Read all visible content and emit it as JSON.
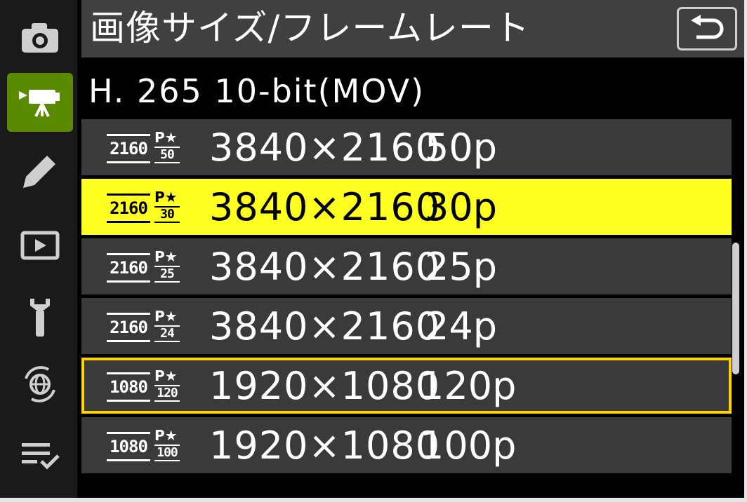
{
  "header": {
    "title": "画像サイズ/フレームレート"
  },
  "subtitle": "H. 265 10-bit(MOV)",
  "sidebar": {
    "items": [
      {
        "icon": "camera-icon"
      },
      {
        "icon": "movie-camera-icon",
        "active": true
      },
      {
        "icon": "pencil-icon"
      },
      {
        "icon": "playback-icon"
      },
      {
        "icon": "wrench-icon"
      },
      {
        "icon": "network-icon"
      },
      {
        "icon": "my-menu-icon"
      }
    ]
  },
  "rows": [
    {
      "badge_res": "2160",
      "badge_p": "P★",
      "badge_fps": "50",
      "resolution": "3840×2160",
      "fps": "50p",
      "state": "normal"
    },
    {
      "badge_res": "2160",
      "badge_p": "P★",
      "badge_fps": "30",
      "resolution": "3840×2160",
      "fps": "30p",
      "state": "selected"
    },
    {
      "badge_res": "2160",
      "badge_p": "P★",
      "badge_fps": "25",
      "resolution": "3840×2160",
      "fps": "25p",
      "state": "normal"
    },
    {
      "badge_res": "2160",
      "badge_p": "P★",
      "badge_fps": "24",
      "resolution": "3840×2160",
      "fps": "24p",
      "state": "normal"
    },
    {
      "badge_res": "1080",
      "badge_p": "P★",
      "badge_fps": "120",
      "resolution": "1920×1080",
      "fps": "120p",
      "state": "highlighted"
    },
    {
      "badge_res": "1080",
      "badge_p": "P★",
      "badge_fps": "100",
      "resolution": "1920×1080",
      "fps": "100p",
      "state": "normal"
    }
  ],
  "colors": {
    "selected_bg": "#ffff21",
    "highlight_border": "#ffd200",
    "active_tab": "#5a8a00"
  }
}
